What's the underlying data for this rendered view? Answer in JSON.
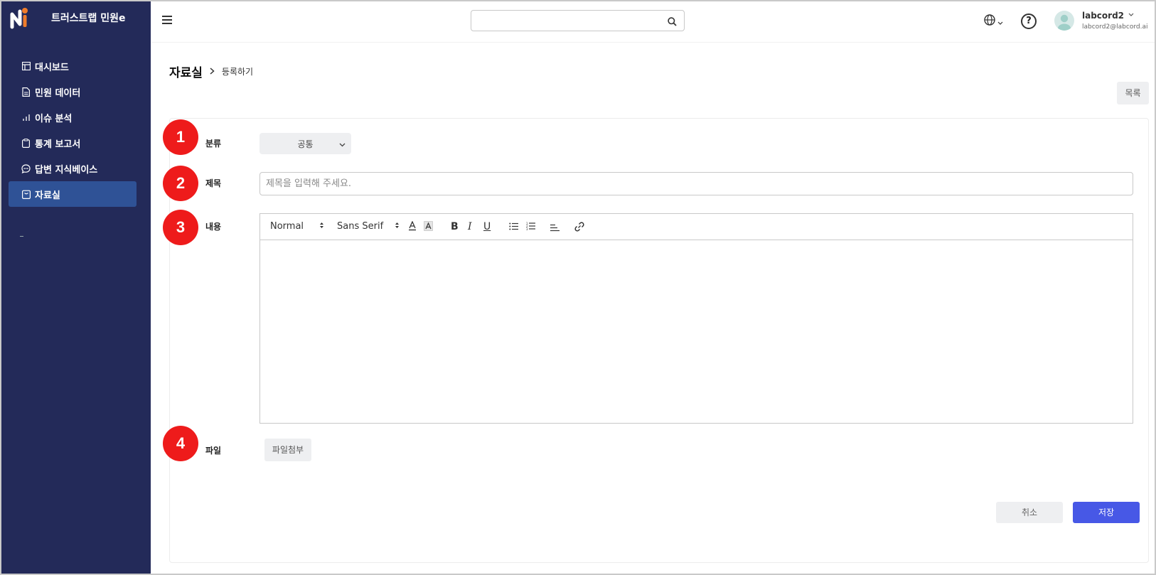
{
  "brand": {
    "name": "트러스트랩 민원e"
  },
  "sidebar": {
    "items": [
      {
        "label": "대시보드",
        "icon": "layout-icon"
      },
      {
        "label": "민원 데이터",
        "icon": "document-icon"
      },
      {
        "label": "이슈 분석",
        "icon": "bar-chart-icon"
      },
      {
        "label": "통계 보고서",
        "icon": "clipboard-icon"
      },
      {
        "label": "답변 지식베이스",
        "icon": "chat-icon"
      },
      {
        "label": "자료실",
        "icon": "archive-icon",
        "active": true
      }
    ]
  },
  "topbar": {
    "search_placeholder": "",
    "user_name": "labcord2",
    "user_email": "labcord2@labcord.ai"
  },
  "breadcrumb": {
    "main": "자료실",
    "sub": "등록하기"
  },
  "actions": {
    "list_label": "목록",
    "cancel_label": "취소",
    "save_label": "저장"
  },
  "form": {
    "category": {
      "label": "분류",
      "value": "공통",
      "badge": "1"
    },
    "title": {
      "label": "제목",
      "placeholder": "제목을 입력해 주세요.",
      "badge": "2"
    },
    "content": {
      "label": "내용",
      "badge": "3",
      "toolbar": {
        "size": "Normal",
        "font": "Sans Serif",
        "bold": "B",
        "italic": "I",
        "underline": "U"
      }
    },
    "file": {
      "label": "파일",
      "button_label": "파일첨부",
      "badge": "4"
    }
  },
  "colors": {
    "sidebar": "#232a59",
    "active_nav": "#2f5296",
    "primary": "#4758e6",
    "badge": "#ee1b1b"
  }
}
